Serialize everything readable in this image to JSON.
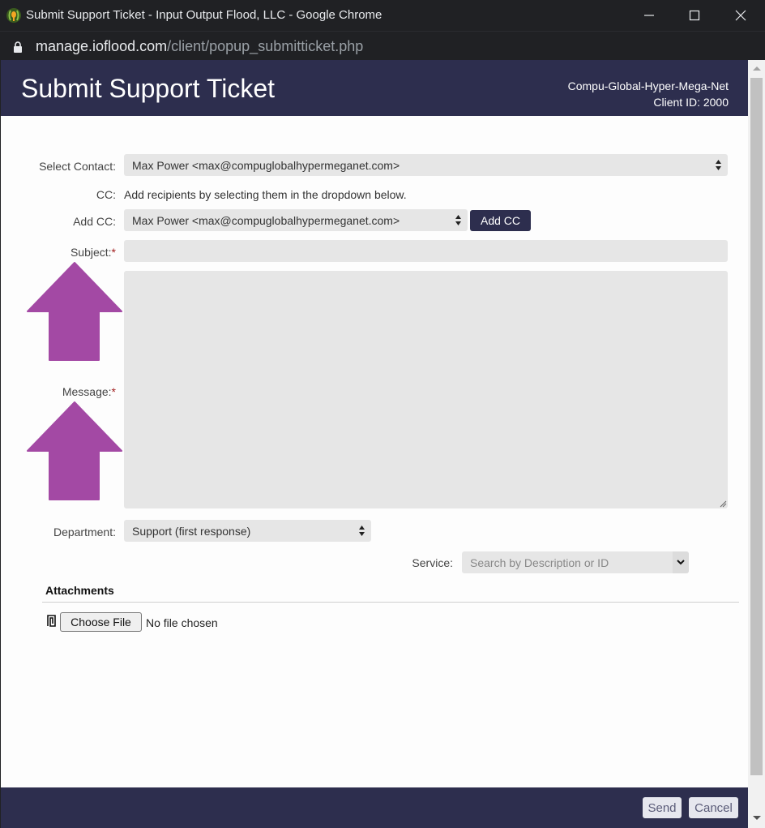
{
  "browser": {
    "window_title": "Submit Support Ticket - Input Output Flood, LLC - Google Chrome",
    "url_host": "manage.ioflood.com",
    "url_path": "/client/popup_submitticket.php"
  },
  "header": {
    "title": "Submit Support Ticket",
    "org_name": "Compu-Global-Hyper-Mega-Net",
    "client_id": "Client ID: 2000"
  },
  "form": {
    "select_contact": {
      "label": "Select Contact:",
      "value": "Max Power <max@compuglobalhypermeganet.com>"
    },
    "cc": {
      "label": "CC:",
      "note": "Add recipients by selecting them in the dropdown below."
    },
    "add_cc": {
      "label": "Add CC:",
      "value": "Max Power <max@compuglobalhypermeganet.com>",
      "button": "Add CC"
    },
    "subject": {
      "label": "Subject:",
      "required_mark": "*",
      "value": ""
    },
    "message": {
      "label": "Message:",
      "required_mark": "*",
      "value": ""
    },
    "department": {
      "label": "Department:",
      "value": "Support (first response)"
    },
    "service": {
      "label": "Service:",
      "placeholder": "Search by Description or ID"
    }
  },
  "attachments": {
    "title": "Attachments",
    "choose_file": "Choose File",
    "status": "No file chosen"
  },
  "footer": {
    "send": "Send",
    "cancel": "Cancel"
  },
  "annotations": {
    "arrow_color": "#a349a4",
    "count": 2
  },
  "colors": {
    "brand": "#2d2e4e",
    "field_bg": "#e6e6e6",
    "required": "#a32020"
  }
}
